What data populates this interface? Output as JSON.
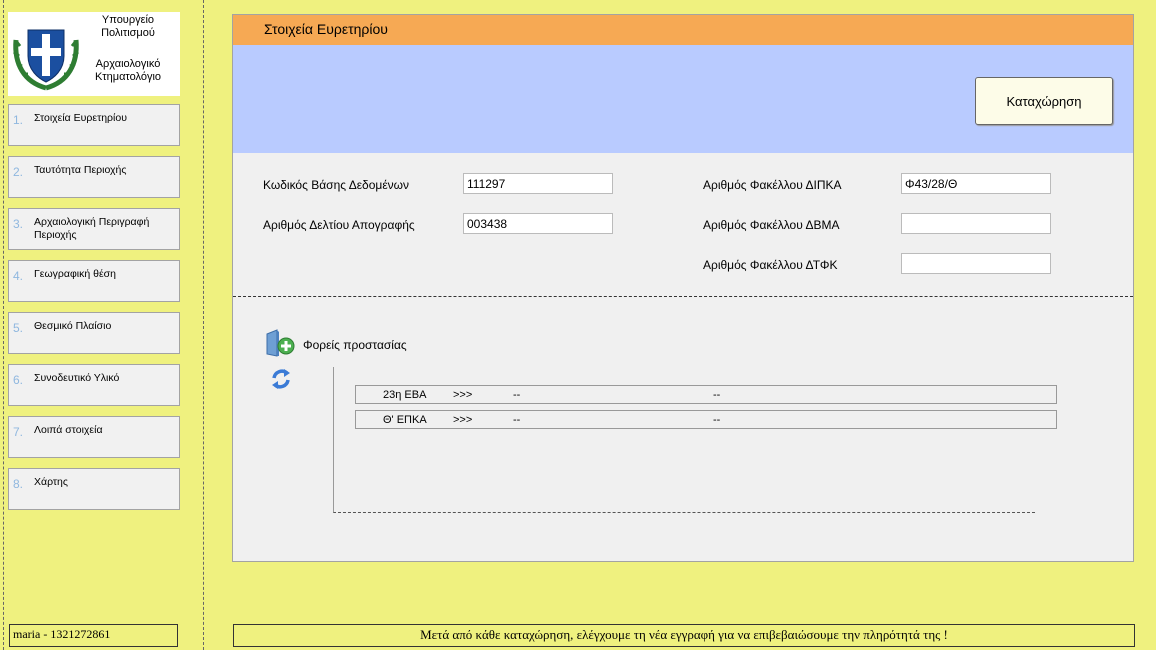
{
  "logo": {
    "ministry_line1": "Υπουργείο",
    "ministry_line2": "Πολιτισμού",
    "subtitle_line1": "Αρχαιολογικό",
    "subtitle_line2": "Κτηματολόγιο"
  },
  "sidebar": {
    "items": [
      {
        "num": "1.",
        "label": "Στοιχεία Ευρετηρίου"
      },
      {
        "num": "2.",
        "label": "Ταυτότητα Περιοχής"
      },
      {
        "num": "3.",
        "label": "Αρχαιολογική Περιγραφή Περιοχής"
      },
      {
        "num": "4.",
        "label": "Γεωγραφική θέση"
      },
      {
        "num": "5.",
        "label": "Θεσμικό Πλαίσιο"
      },
      {
        "num": "6.",
        "label": "Συνοδευτικό Υλικό"
      },
      {
        "num": "7.",
        "label": "Λοιπά στοιχεία"
      },
      {
        "num": "8.",
        "label": "Χάρτης"
      }
    ],
    "user": "maria - 1321272861"
  },
  "panel": {
    "title": "Στοιχεία Ευρετηρίου",
    "save_label": "Καταχώρηση",
    "fields": {
      "db_code_label": "Κωδικός Βάσης Δεδομένων",
      "db_code_value": "111297",
      "inventory_label": "Αριθμός Δελτίου Απογραφής",
      "inventory_value": "003438",
      "dipka_label": "Αριθμός Φακέλλου ΔΙΠΚΑ",
      "dipka_value": "Φ43/28/Θ",
      "dvma_label": "Αριθμός Φακέλλου ΔΒΜΑ",
      "dvma_value": "",
      "dtfk_label": "Αριθμός Φακέλλου ΔΤΦΚ",
      "dtfk_value": ""
    },
    "protection_label": "Φορείς προστασίας",
    "protection_rows": [
      {
        "name": "23η ΕΒΑ",
        "arrow": ">>>",
        "col1": "--",
        "col2": "--"
      },
      {
        "name": "Θ' ΕΠΚΑ",
        "arrow": ">>>",
        "col1": "--",
        "col2": "--"
      }
    ]
  },
  "footer": {
    "message": "Μετά από κάθε καταχώρηση, ελέγχουμε τη νέα εγγραφή για να επιβεβαιώσουμε την πληρότητά της !"
  },
  "colors": {
    "background": "#eff17f",
    "header": "#f6a954",
    "band": "#b9cbff",
    "nav_number": "#8fb7df"
  }
}
